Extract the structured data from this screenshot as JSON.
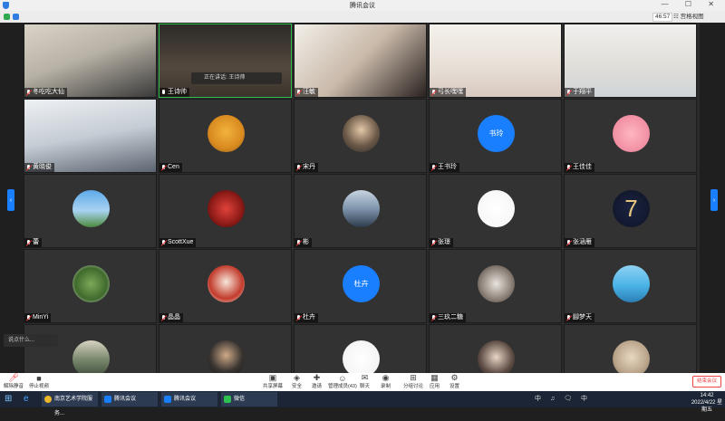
{
  "window": {
    "title": "腾讯会议",
    "controls": "— ☐ ✕"
  },
  "infobar": {
    "timer": "46:57",
    "view_label": "☷ 宫格视图"
  },
  "speaking_tip": "正在讲话: 王诗帅",
  "participants": [
    {
      "name": "冬吃吃大仙",
      "kind": "video",
      "scene": "office-man"
    },
    {
      "name": "王诗帅",
      "kind": "video",
      "scene": "dark-room-man",
      "speaking": true
    },
    {
      "name": "汪敏",
      "kind": "video",
      "scene": "woman-closeup"
    },
    {
      "name": "弓长嘿嘿",
      "kind": "video",
      "scene": "woman-white-wall"
    },
    {
      "name": "于翔平",
      "kind": "video",
      "scene": "woman-white-wall-2"
    },
    {
      "name": "黄晓俊",
      "kind": "video",
      "scene": "office-man-2"
    },
    {
      "name": "Cen",
      "kind": "avatar",
      "avatar": "pooh"
    },
    {
      "name": "宋丹",
      "kind": "avatar",
      "avatar": "person-photo"
    },
    {
      "name": "王书玲",
      "kind": "avatar-text",
      "avatar_text": "书玲",
      "color": "#1a7fff"
    },
    {
      "name": "王佳佳",
      "kind": "avatar",
      "avatar": "pig"
    },
    {
      "name": "蕾",
      "kind": "avatar",
      "avatar": "sky"
    },
    {
      "name": "ScottXue",
      "kind": "avatar",
      "avatar": "red-portrait"
    },
    {
      "name": "彬",
      "kind": "avatar",
      "avatar": "lake"
    },
    {
      "name": "张璟",
      "kind": "avatar",
      "avatar": "white-sketch"
    },
    {
      "name": "张涵雁",
      "kind": "avatar",
      "avatar": "number-seven"
    },
    {
      "name": "MinYi",
      "kind": "avatar",
      "avatar": "robot"
    },
    {
      "name": "晶晶",
      "kind": "avatar",
      "avatar": "opera"
    },
    {
      "name": "杜卉",
      "kind": "avatar-text",
      "avatar_text": "杜卉",
      "color": "#1a7fff"
    },
    {
      "name": "三玖二糖",
      "kind": "avatar",
      "avatar": "anime"
    },
    {
      "name": "腳梦天",
      "kind": "avatar",
      "avatar": "ocean"
    },
    {
      "name": "",
      "kind": "avatar",
      "avatar": "street"
    },
    {
      "name": "",
      "kind": "avatar",
      "avatar": "man-dark"
    },
    {
      "name": "",
      "kind": "avatar",
      "avatar": "frog-sketch"
    },
    {
      "name": "",
      "kind": "avatar",
      "avatar": "sunglasses"
    },
    {
      "name": "",
      "kind": "avatar",
      "avatar": "beige-toy"
    }
  ],
  "chat_preview": "说点什么...",
  "toolbar": {
    "unmute": "解除静音",
    "stop_video": "停止视频",
    "share": "共享屏幕",
    "security": "安全",
    "invite": "邀请",
    "members": "管理成员(43)",
    "chat": "聊天",
    "record": "录制",
    "breakout": "分组讨论",
    "apps": "应用",
    "settings": "设置",
    "end": "结束会议"
  },
  "taskbar": {
    "browser_task": "南京艺术学院服务...",
    "meeting_task_1": "腾讯会议",
    "meeting_task_2": "腾讯会议",
    "wechat_task": "微信",
    "tray_text": "中 ♫ 🗨 中",
    "time": "14:42",
    "date": "2022/4/22 星期五"
  }
}
